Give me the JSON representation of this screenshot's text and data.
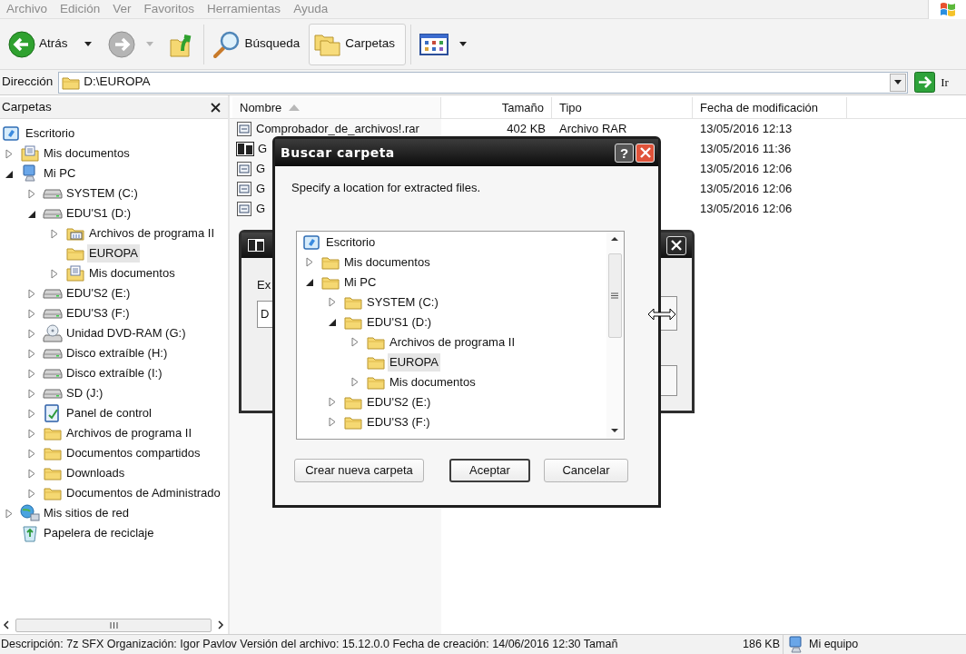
{
  "menu_bar": [
    "Archivo",
    "Edición",
    "Ver",
    "Favoritos",
    "Herramientas",
    "Ayuda"
  ],
  "toolbar": [
    {
      "kind": "back",
      "label": "Atrás",
      "disabled": false,
      "selected": false
    },
    {
      "kind": "forward",
      "disabled": true,
      "selected": false
    },
    {
      "kind": "up",
      "disabled": false,
      "selected": false
    },
    {
      "kind": "search",
      "label": "Búsqueda",
      "disabled": false,
      "selected": false
    },
    {
      "kind": "folders",
      "label": "Carpetas",
      "disabled": false,
      "selected": true
    },
    {
      "kind": "views",
      "disabled": false,
      "selected": false
    }
  ],
  "address_bar": {
    "label": "Dirección",
    "value": "D:\\EUROPA",
    "go_label": "Ir"
  },
  "folders_pane": {
    "title": "Carpetas",
    "tree": [
      {
        "label": "Escritorio",
        "kind": "desktop",
        "selected": false,
        "children": [
          {
            "label": "Mis documentos",
            "kind": "documents",
            "expandable": true,
            "expanded": false,
            "selected": false
          },
          {
            "label": "Mi PC",
            "kind": "computer",
            "expandable": true,
            "expanded": true,
            "selected": false,
            "children": [
              {
                "label": "SYSTEM (C:)",
                "kind": "drive",
                "expandable": true,
                "expanded": false,
                "selected": false
              },
              {
                "label": "EDU'S1 (D:)",
                "kind": "drive",
                "expandable": true,
                "expanded": true,
                "selected": false,
                "children": [
                  {
                    "label": "Archivos de programa II",
                    "kind": "program-folder",
                    "expandable": true,
                    "expanded": false,
                    "selected": false
                  },
                  {
                    "label": "EUROPA",
                    "kind": "folder",
                    "expandable": false,
                    "selected": true
                  },
                  {
                    "label": "Mis documentos",
                    "kind": "documents",
                    "expandable": true,
                    "expanded": false,
                    "selected": false
                  }
                ]
              },
              {
                "label": "EDU'S2 (E:)",
                "kind": "drive",
                "expandable": true,
                "expanded": false,
                "selected": false
              },
              {
                "label": "EDU'S3 (F:)",
                "kind": "drive",
                "expandable": true,
                "expanded": false,
                "selected": false
              },
              {
                "label": "Unidad DVD-RAM (G:)",
                "kind": "dvd",
                "expandable": true,
                "expanded": false,
                "selected": false
              },
              {
                "label": "Disco extraíble (H:)",
                "kind": "drive",
                "expandable": true,
                "expanded": false,
                "selected": false
              },
              {
                "label": "Disco extraíble (I:)",
                "kind": "drive",
                "expandable": true,
                "expanded": false,
                "selected": false
              },
              {
                "label": "SD (J:)",
                "kind": "drive",
                "expandable": true,
                "expanded": false,
                "selected": false
              },
              {
                "label": "Panel de control",
                "kind": "control-panel",
                "expandable": true,
                "expanded": false,
                "selected": false
              },
              {
                "label": "Archivos de programa II",
                "kind": "folder",
                "expandable": true,
                "expanded": false,
                "selected": false
              },
              {
                "label": "Documentos compartidos",
                "kind": "folder",
                "expandable": true,
                "expanded": false,
                "selected": false
              },
              {
                "label": "Downloads",
                "kind": "folder",
                "expandable": true,
                "expanded": false,
                "selected": false
              },
              {
                "label": "Documentos de Administrado",
                "kind": "folder",
                "expandable": true,
                "expanded": false,
                "selected": false
              }
            ]
          },
          {
            "label": "Mis sitios de red",
            "kind": "network",
            "expandable": true,
            "expanded": false,
            "selected": false
          },
          {
            "label": "Papelera de reciclaje",
            "kind": "recycle",
            "expandable": false,
            "selected": false
          }
        ]
      }
    ]
  },
  "file_list": {
    "columns": [
      {
        "label": "Nombre",
        "sorted": true
      },
      {
        "label": "Tamaño",
        "sorted": false
      },
      {
        "label": "Tipo",
        "sorted": false
      },
      {
        "label": "Fecha de modificación",
        "sorted": false
      }
    ],
    "rows": [
      {
        "kind": "archive",
        "name": "Comprobador_de_archivos!.rar",
        "size": "402 KB",
        "type": "Archivo RAR",
        "modified": "13/05/2016 12:13"
      },
      {
        "kind": "sevenzip",
        "name": "G",
        "modified": "13/05/2016 11:36"
      },
      {
        "kind": "archive",
        "name": "G",
        "modified": "13/05/2016 12:06"
      },
      {
        "kind": "archive",
        "name": "G",
        "modified": "13/05/2016 12:06"
      },
      {
        "kind": "archive",
        "name": "G",
        "modified": "13/05/2016 12:06"
      }
    ]
  },
  "extract_dialog": {
    "field_label": "Ex",
    "field_value": "D"
  },
  "browse_dialog": {
    "title": "Buscar carpeta",
    "help": "?",
    "prompt": "Specify a location for extracted files.",
    "tree": [
      {
        "label": "Escritorio",
        "kind": "desktop",
        "selected": false,
        "children": [
          {
            "label": "Mis documentos",
            "kind": "folder",
            "expandable": true,
            "expanded": false,
            "selected": false
          },
          {
            "label": "Mi PC",
            "kind": "folder",
            "expandable": true,
            "expanded": true,
            "selected": false,
            "children": [
              {
                "label": "SYSTEM (C:)",
                "kind": "folder",
                "expandable": true,
                "expanded": false,
                "selected": false
              },
              {
                "label": "EDU'S1 (D:)",
                "kind": "folder",
                "expandable": true,
                "expanded": true,
                "selected": false,
                "children": [
                  {
                    "label": "Archivos de programa II",
                    "kind": "folder",
                    "expandable": true,
                    "expanded": false,
                    "selected": false
                  },
                  {
                    "label": "EUROPA",
                    "kind": "folder",
                    "expandable": false,
                    "selected": true
                  },
                  {
                    "label": "Mis documentos",
                    "kind": "folder",
                    "expandable": true,
                    "expanded": false,
                    "selected": false
                  }
                ]
              },
              {
                "label": "EDU'S2 (E:)",
                "kind": "folder",
                "expandable": true,
                "expanded": false,
                "selected": false
              },
              {
                "label": "EDU'S3 (F:)",
                "kind": "folder",
                "expandable": true,
                "expanded": false,
                "selected": false
              }
            ]
          }
        ]
      }
    ],
    "buttons": [
      {
        "label": "Crear nueva carpeta",
        "default": false
      },
      {
        "label": "Aceptar",
        "default": true
      },
      {
        "label": "Cancelar",
        "default": false
      }
    ]
  },
  "status_bar": {
    "description": "Descripción: 7z SFX Organización: Igor Pavlov Versión del archivo: 15.12.0.0 Fecha de creación: 14/06/2016 12:30 Tamañ",
    "size": "186 KB",
    "zone": "Mi equipo"
  }
}
